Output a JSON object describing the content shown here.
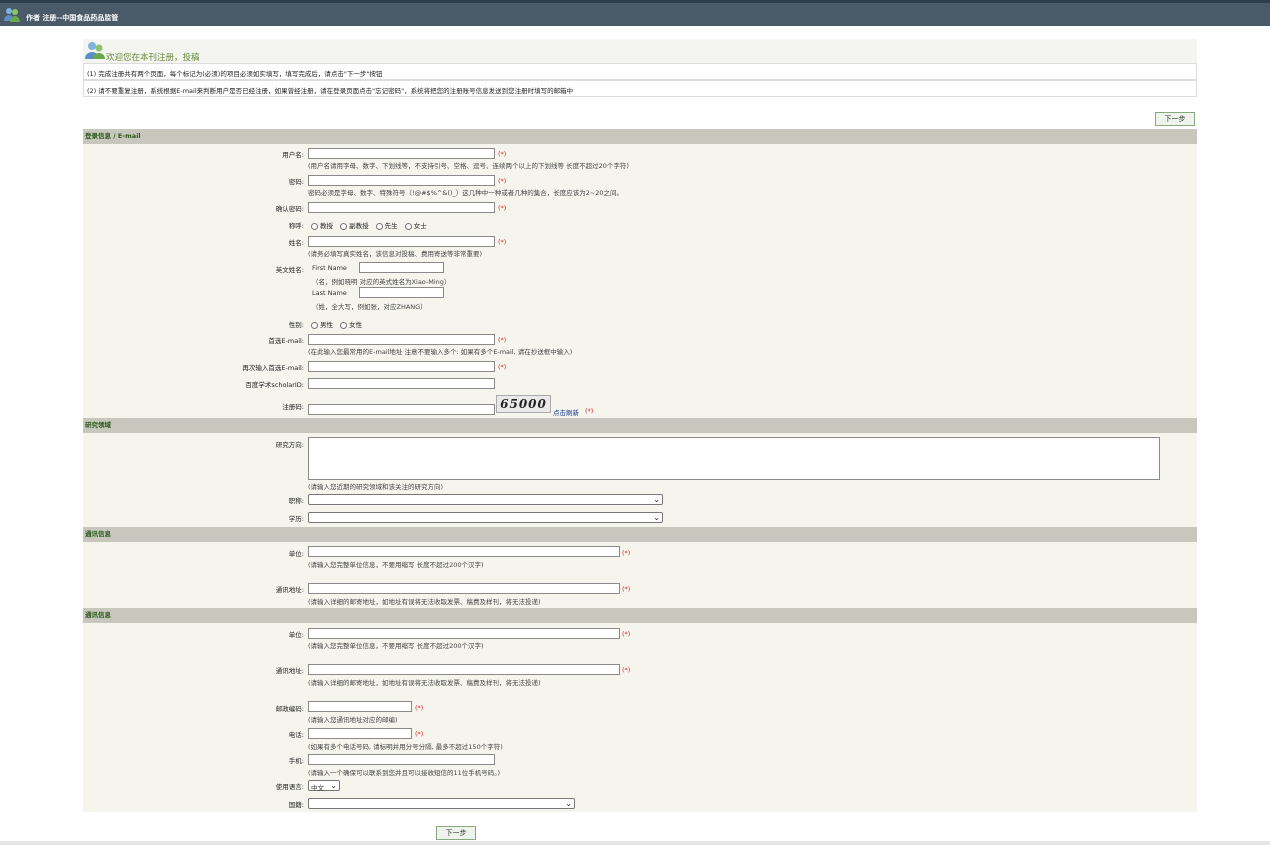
{
  "header": {
    "title": "作者  注册--中国食品药品监管",
    "icon": "users-icon"
  },
  "welcome": {
    "text": "欢迎您在本刊注册，投稿",
    "icon": "users-icon"
  },
  "notes": [
    "(1) 完成注册共有两个页面，每个标记为(必须)的项目必须如实填写，填写完成后，请点击\"下一步\"按钮",
    "(2) 请不要重复注册，系统根据E-mail来判断用户是否已经注册，如果曾经注册，请在登录页面点击\"忘记密码\"，系统将把您的注册账号信息发送到您注册时填写的邮箱中"
  ],
  "next_label": "下一步",
  "required_mark": "(*)",
  "sections": {
    "login": "登录信息 / E-mail",
    "research": "研究领域",
    "comm1": "通讯信息",
    "comm2": "通讯信息"
  },
  "login": {
    "username_label": "用户名:",
    "username_hint": "(用户名请用字母、数字、下划线等，不支持引号、空格、逗号、连续两个以上的下划线等 长度不超过20个字符)",
    "password_label": "密码:",
    "password_hint": "密码必须是字母、数字、特殊符号（!@#$%^&()_）这几种中一种或者几种的集合，长度应该为2~20之间。",
    "confirm_label": "确认密码:",
    "title_label": "称呼:",
    "title_options": [
      "教授",
      "副教授",
      "先生",
      "女士"
    ],
    "name_label": "姓名:",
    "name_hint": "(请务必填写真实姓名，该信息对投稿、费用寄送等非常重要)",
    "en_name_label": "英文姓名:",
    "first_name_label": "First Name",
    "first_name_hint": "（名，例如晓明 对应的英式姓名为Xiao-Ming）",
    "last_name_label": "Last Name",
    "last_name_hint": "（姓，全大写，例如张，对应ZHANG）",
    "gender_label": "性别:",
    "gender_options": [
      "男性",
      "女性"
    ],
    "email_label": "首选E-mail:",
    "email_hint": "(在此输入您最常用的E-mail地址 注意不要输入多个: 如果有多个E-mail, 请在抄送框中输入)",
    "email2_label": "再次输入首选E-mail:",
    "scholar_label": "百度学术scholarID:",
    "captcha_label": "注册码:",
    "captcha_text": "65000",
    "captcha_refresh": "点击刷新"
  },
  "research": {
    "direction_label": "研究方向:",
    "direction_hint": "(请输入您近期的研究领域和该关注的研究方向)",
    "rank_label": "职称:",
    "degree_label": "学历:"
  },
  "comm1": {
    "unit_label": "单位:",
    "unit_hint": "(请输入您完整单位信息，不要用缩写 长度不超过200个汉字)",
    "address_label": "通讯地址:",
    "address_hint": "(请输入详细的邮寄地址，如地址有误将无法收取发票、稿费及样刊，将无法投递)"
  },
  "comm2": {
    "unit_label": "单位:",
    "unit_hint": "(请输入您完整单位信息，不要用缩写 长度不超过200个汉字)",
    "address_label": "通讯地址:",
    "address_hint": "(请输入详细的邮寄地址，如地址有误将无法收取发票、稿费及样刊，将无法投递)",
    "zip_label": "邮政编码:",
    "zip_hint": "(请输入您通讯地址对应的邮编)",
    "phone_label": "电话:",
    "phone_hint": "(如果有多个电话号码, 请标明并用分号分隔, 最多不超过150个字符)",
    "mobile_label": "手机:",
    "mobile_hint": "(请输入一个确保可以联系到您并且可以接收短信的11位手机号码。)",
    "lang_label": "使用语言:",
    "lang_value": "中文",
    "country_label": "国籍:"
  }
}
